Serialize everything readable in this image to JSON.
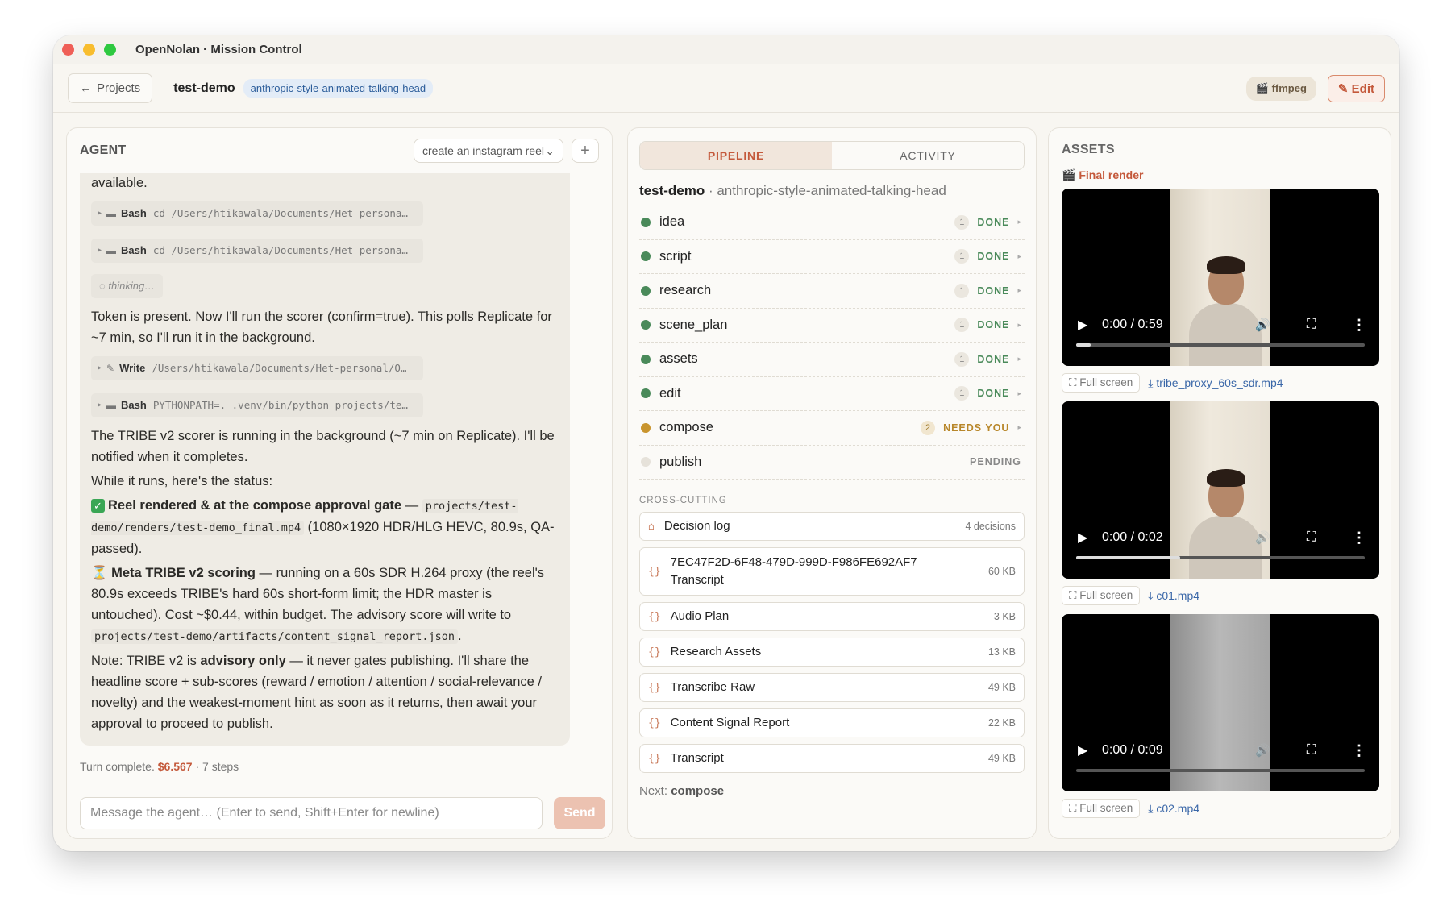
{
  "window": {
    "title": "OpenNolan · Mission Control"
  },
  "topbar": {
    "back_label": "Projects",
    "project_name": "test-demo",
    "template_tag": "anthropic-style-animated-talking-head",
    "ffmpeg_chip": "ffmpeg",
    "edit_label": "Edit"
  },
  "agent": {
    "title": "AGENT",
    "preset_value": "create an instagram reel",
    "messages": {
      "m1": "Signal tool. Let me check the invocation pattern and that the Replicate token is available.",
      "tool1_name": "Bash",
      "tool1_cmd": "cd /Users/htikawala/Documents/Het-persona…",
      "tool2_name": "Bash",
      "tool2_cmd": "cd /Users/htikawala/Documents/Het-persona…",
      "thinking": "thinking…",
      "m2": "Token is present. Now I'll run the scorer (confirm=true). This polls Replicate for ~7 min, so I'll run it in the background.",
      "tool3_name": "Write",
      "tool3_cmd": "/Users/htikawala/Documents/Het-personal/O…",
      "tool4_name": "Bash",
      "tool4_cmd": "PYTHONPATH=. .venv/bin/python projects/te…",
      "m3": "The TRIBE v2 scorer is running in the background (~7 min on Replicate). I'll be notified when it completes.",
      "m4": "While it runs, here's the status:",
      "s1_bold": "Reel rendered & at the compose approval gate",
      "s1_dash": " — ",
      "s1_code": "projects/test-demo/renders/test-demo_final.mp4",
      "s1_rest": " (1080×1920 HDR/HLG HEVC, 80.9s, QA-passed).",
      "s2_bold": "Meta TRIBE v2 scoring",
      "s2_rest": " — running on a 60s SDR H.264 proxy (the reel's 80.9s exceeds TRIBE's hard 60s short-form limit; the HDR master is untouched). Cost ~$0.44, within budget. The advisory score will write to ",
      "s2_code": "projects/test-demo/artifacts/content_signal_report.json",
      "s2_end": ".",
      "n_pre": "Note: TRIBE v2 is ",
      "n_bold": "advisory only",
      "n_rest": " — it never gates publishing. I'll share the headline score + sub-scores (reward / emotion / attention / social-relevance / novelty) and the weakest-moment hint as soon as it returns, then await your approval to proceed to publish."
    },
    "turn_prefix": "Turn complete.",
    "turn_cost": "$6.567",
    "turn_steps": "· 7 steps",
    "composer_placeholder": "Message the agent…  (Enter to send, Shift+Enter for newline)",
    "send_label": "Send"
  },
  "pipeline": {
    "tabs": [
      "PIPELINE",
      "ACTIVITY"
    ],
    "project": "test-demo",
    "template": "· anthropic-style-animated-talking-head",
    "stages": [
      {
        "name": "idea",
        "count": "1",
        "status": "DONE",
        "color": "#4a8a5a"
      },
      {
        "name": "script",
        "count": "1",
        "status": "DONE",
        "color": "#4a8a5a"
      },
      {
        "name": "research",
        "count": "1",
        "status": "DONE",
        "color": "#4a8a5a"
      },
      {
        "name": "scene_plan",
        "count": "1",
        "status": "DONE",
        "color": "#4a8a5a"
      },
      {
        "name": "assets",
        "count": "1",
        "status": "DONE",
        "color": "#4a8a5a"
      },
      {
        "name": "edit",
        "count": "1",
        "status": "DONE",
        "color": "#4a8a5a"
      },
      {
        "name": "compose",
        "count": "2",
        "status": "NEEDS YOU",
        "color": "#c9952e"
      },
      {
        "name": "publish",
        "count": "",
        "status": "PENDING",
        "color": "#e6e2da"
      }
    ],
    "cross_cutting_label": "CROSS-CUTTING",
    "artifacts": [
      {
        "icon": "⌂",
        "name": "Decision log",
        "size": "4 decisions"
      },
      {
        "icon": "{}",
        "name": "7EC47F2D-6F48-479D-999D-F986FE692AF7 Transcript",
        "size": "60 KB"
      },
      {
        "icon": "{}",
        "name": "Audio Plan",
        "size": "3 KB"
      },
      {
        "icon": "{}",
        "name": "Research Assets",
        "size": "13 KB"
      },
      {
        "icon": "{}",
        "name": "Transcribe Raw",
        "size": "49 KB"
      },
      {
        "icon": "{}",
        "name": "Content Signal Report",
        "size": "22 KB"
      },
      {
        "icon": "{}",
        "name": "Transcript",
        "size": "49 KB"
      }
    ],
    "next_prefix": "Next:",
    "next_stage": "compose"
  },
  "assets": {
    "title": "ASSETS",
    "final_render_label": "Final render",
    "fullscreen_label": "Full screen",
    "videos": [
      {
        "time": "0:00 / 0:59",
        "file": "tribe_proxy_60s_sdr.mp4",
        "progress": 0.05
      },
      {
        "time": "0:00 / 0:02",
        "file": "c01.mp4",
        "progress": 0.36
      },
      {
        "time": "0:00 / 0:09",
        "file": "c02.mp4",
        "progress": 0.0
      }
    ]
  }
}
